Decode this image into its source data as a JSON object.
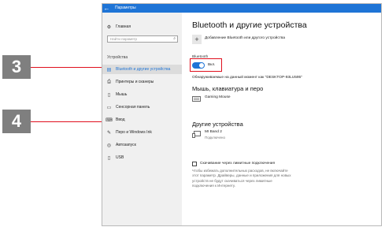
{
  "callouts": {
    "three": "3",
    "four": "4"
  },
  "window": {
    "title": "Параметры",
    "back_glyph": "←"
  },
  "sidebar": {
    "home": {
      "icon": "home-icon",
      "glyph": "⚙",
      "label": "Главная"
    },
    "search_placeholder": "Найти параметр",
    "search_icon": "search-icon",
    "section_label": "Устройства",
    "items": [
      {
        "icon": "bluetooth-icon",
        "glyph": "▤",
        "label": "Bluetooth и другие устройства",
        "active": true
      },
      {
        "icon": "printer-icon",
        "glyph": "⎙",
        "label": "Принтеры и сканеры"
      },
      {
        "icon": "mouse-icon",
        "glyph": "▯",
        "label": "Мышь"
      },
      {
        "icon": "touchpad-icon",
        "glyph": "▭",
        "label": "Сенсорная панель"
      },
      {
        "icon": "keyboard-icon",
        "glyph": "⌨",
        "label": "Ввод"
      },
      {
        "icon": "pen-icon",
        "glyph": "✎",
        "label": "Перо и Windows Ink"
      },
      {
        "icon": "autoplay-icon",
        "glyph": "◎",
        "label": "Автозапуск"
      },
      {
        "icon": "usb-icon",
        "glyph": "▯",
        "label": "USB"
      }
    ]
  },
  "main": {
    "title": "Bluetooth и другие устройства",
    "add_device": "Добавление Bluetooth или другого устройства",
    "bluetooth_label": "Bluetooth",
    "toggle_state": "Вкл.",
    "toggle_on": true,
    "discoverable": "Обнаруживаемые на данный момент как \"DESKTOP-93LU595\"",
    "section_input": "Мышь, клавиатура и перо",
    "device_mouse": "Gaming Mouse",
    "section_other": "Другие устройства",
    "device_band": "MI Band 2",
    "device_band_status": "Подключено",
    "metered_label": "Скачивание через лимитные подключения",
    "metered_desc": "Чтобы избежать дополнительных расходов, не включайте этот параметр. Драйверы, данные и приложения для новых устройств не будут скачиваться через лимитные подключения к Интернету."
  },
  "colors": {
    "accent": "#1e74d6",
    "callout_line": "#e0101e",
    "callout_box": "#7f7f7f"
  }
}
